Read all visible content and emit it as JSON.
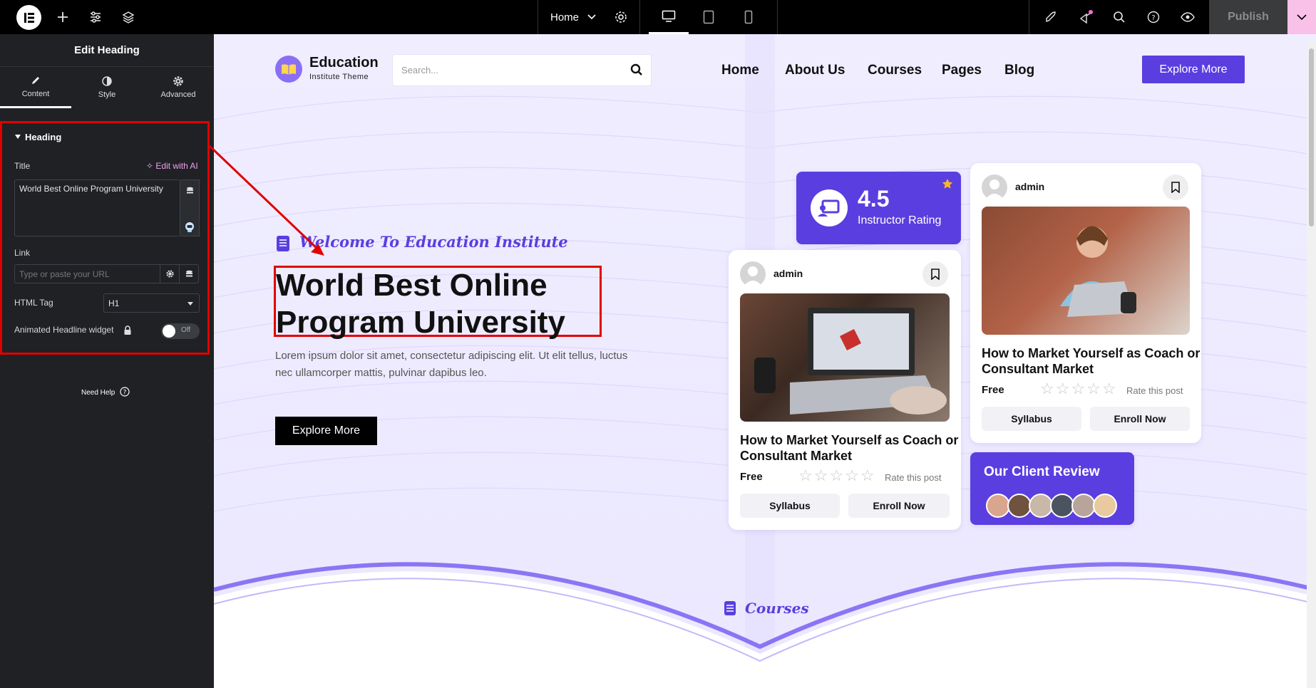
{
  "topbar": {
    "page": "Home",
    "publish": "Publish"
  },
  "panel": {
    "title": "Edit Heading",
    "tabs": [
      {
        "label": "Content"
      },
      {
        "label": "Style"
      },
      {
        "label": "Advanced"
      }
    ],
    "section": "Heading",
    "title_label": "Title",
    "edit_ai": "Edit with AI",
    "title_value": "World Best Online Program University",
    "link_label": "Link",
    "link_placeholder": "Type or paste your URL",
    "html_tag_label": "HTML Tag",
    "html_tag_value": "H1",
    "animated_label": "Animated Headline widget",
    "toggle_off": "Off",
    "need_help": "Need Help"
  },
  "site": {
    "brand": "Education",
    "brand_sub": "Institute Theme",
    "search_placeholder": "Search...",
    "nav": [
      "Home",
      "About Us",
      "Courses",
      "Pages",
      "Blog"
    ],
    "header_button": "Explore More",
    "tagline": "Welcome To Education Institute",
    "heading_line1": "World Best Online",
    "heading_line2": "Program University",
    "body_line1": "Lorem ipsum dolor sit amet, consectetur adipiscing elit. Ut elit tellus, luctus",
    "body_line2": "nec ullamcorper mattis, pulvinar dapibus leo.",
    "hero_button": "Explore More",
    "rating_value": "4.5",
    "rating_label": "Instructor Rating",
    "card1": {
      "author": "admin",
      "title_line1": "How to Market Yourself as Coach or",
      "title_line2": "Consultant Market",
      "price": "Free",
      "rate": "Rate this post",
      "syllabus": "Syllabus",
      "enroll": "Enroll Now"
    },
    "card2": {
      "author": "admin",
      "title_line1": "How to Market Yourself as Coach or",
      "title_line2": "Consultant Market",
      "price": "Free",
      "rate": "Rate this post",
      "syllabus": "Syllabus",
      "enroll": "Enroll Now"
    },
    "review_title": "Our Client Review",
    "courses_label": "Courses"
  },
  "colors": {
    "accent": "#5b3ee0",
    "highlight": "#e00000",
    "panel_bg": "#1f2124"
  }
}
